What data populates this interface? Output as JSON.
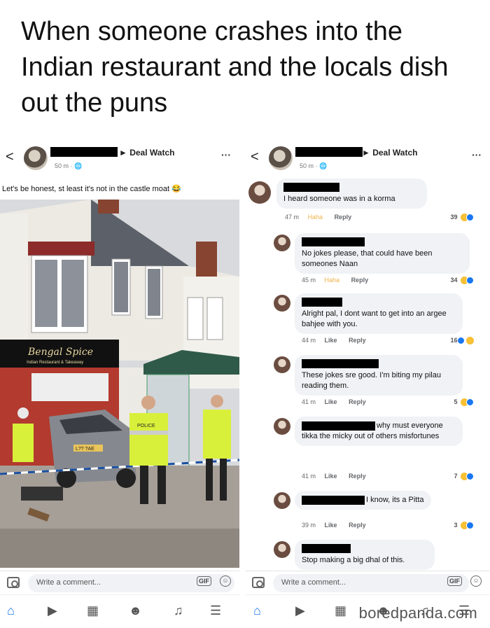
{
  "caption": "When someone crashes into the Indian restaurant and the locals dish out the puns",
  "left_panel": {
    "back": "<",
    "group": "► Deal Watch",
    "meta": "50 m · 🌐",
    "more": "···",
    "post_text": "Let's be honest, st least it's not in the castle moat 😂",
    "shop_sign": "Bengal Spice",
    "shop_sub": "Indian Restaurant & Takeaway",
    "plate": "L?? ?AE",
    "police": "POLICE",
    "comment_placeholder": "Write a comment...",
    "gif": "GIF"
  },
  "right_panel": {
    "back": "<",
    "group": "► Deal Watch",
    "meta": "50 m · 🌐",
    "more": "···",
    "comment_placeholder": "Write a comment...",
    "gif": "GIF",
    "comments": [
      {
        "text": "I heard someone was in a korma",
        "time": "47 m",
        "react_label": "Haha",
        "reply": "Reply",
        "count": "39"
      },
      {
        "text": "No jokes please, that could have been someones Naan",
        "time": "45 m",
        "react_label": "Haha",
        "reply": "Reply",
        "count": "34"
      },
      {
        "text": "Alright pal, I dont want to get into an argee bahjee with you.",
        "time": "44 m",
        "react_label": "Like",
        "reply": "Reply",
        "count": "16"
      },
      {
        "text": "These jokes sre good. I'm biting my pilau reading them.",
        "time": "41 m",
        "react_label": "Like",
        "reply": "Reply",
        "count": "5"
      },
      {
        "text_after_name": "why must everyone",
        "text": "tikka the micky out of others misfortunes",
        "time": "41 m",
        "react_label": "Like",
        "reply": "Reply",
        "count": "7"
      },
      {
        "text_after_name": "I know, its a Pitta",
        "time": "39 m",
        "react_label": "Like",
        "reply": "Reply",
        "count": "3"
      },
      {
        "text": "Stop making a big dhal of this."
      }
    ]
  },
  "nav_icons": [
    "home-icon",
    "video-icon",
    "marketplace-icon",
    "groups-icon",
    "bell-icon",
    "menu-icon"
  ],
  "watermark": "boredpanda.com",
  "colors": {
    "accent": "#1877f2",
    "bubble": "#f0f2f5",
    "haha": "#f0b34a"
  }
}
